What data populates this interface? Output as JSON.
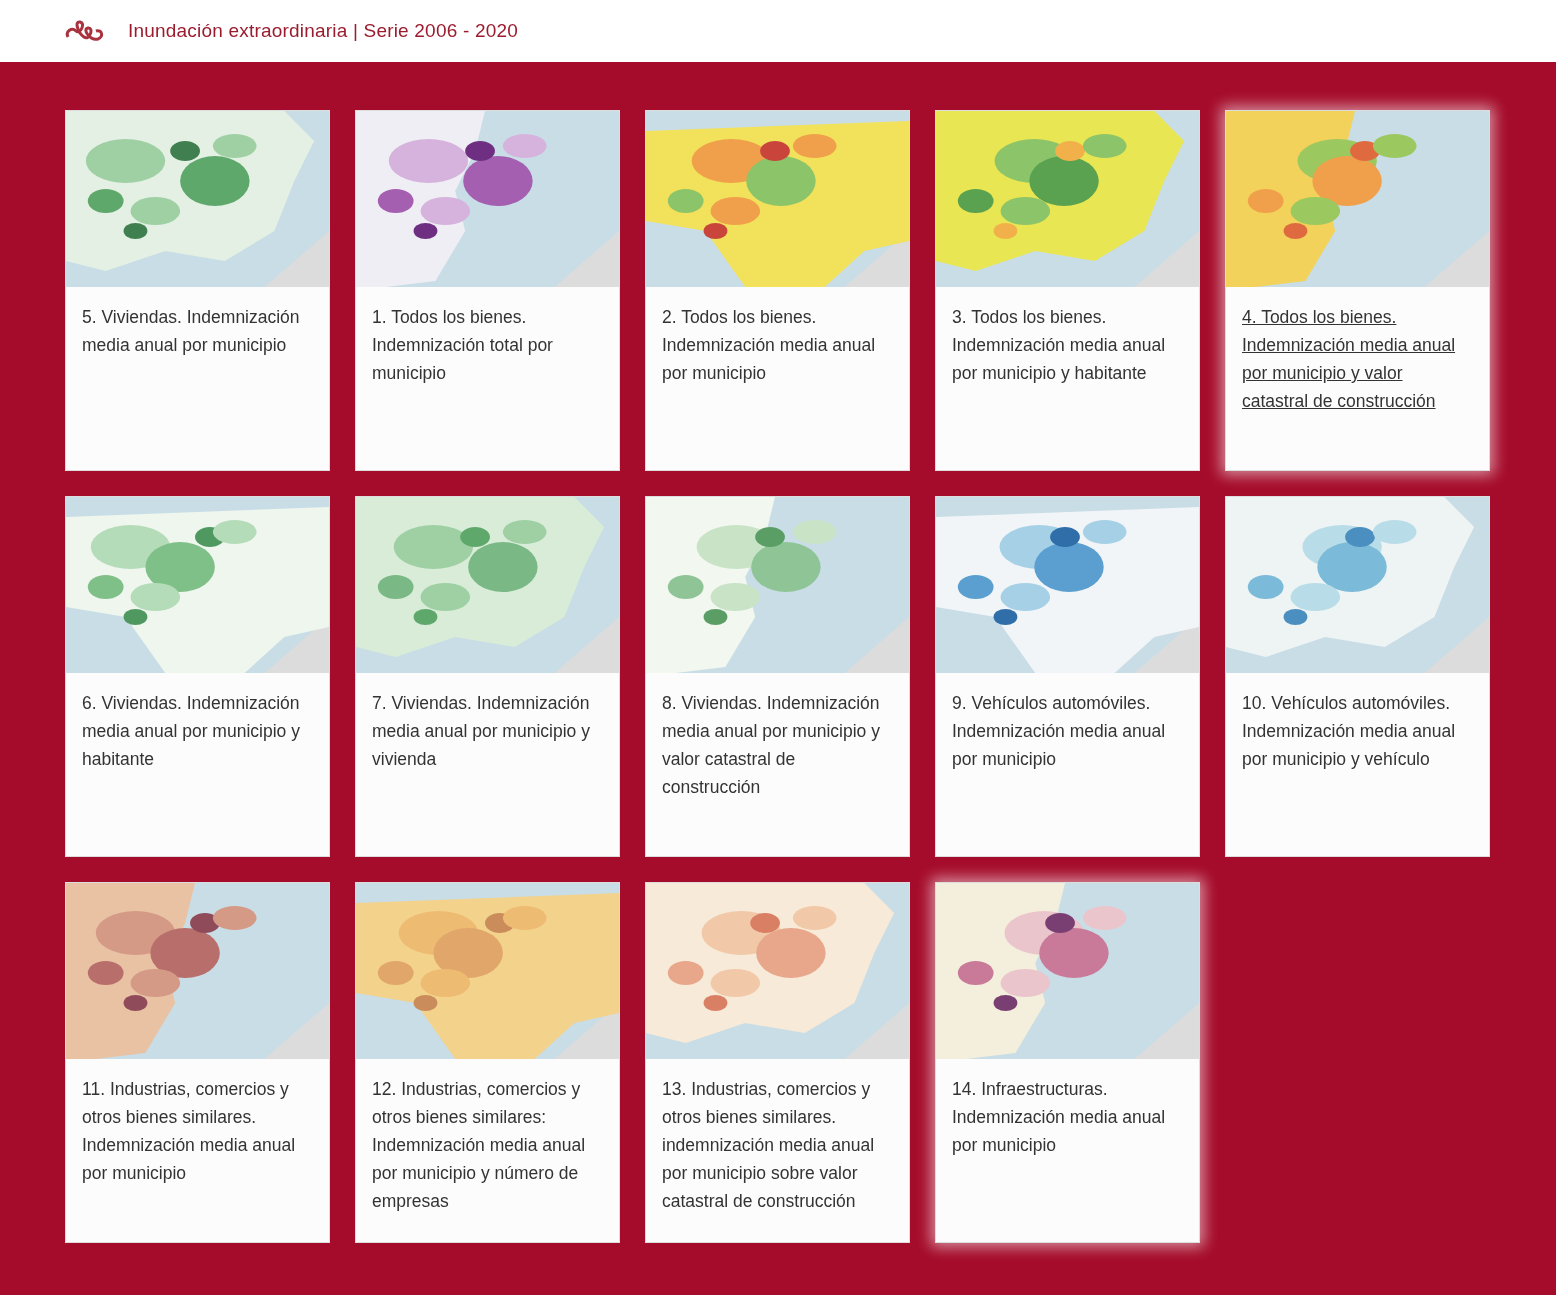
{
  "header": {
    "title": "Inundación extraordinaria | Serie 2006 - 2020"
  },
  "cards": [
    {
      "kind": "picture",
      "title": "5. Viviendas. Indemnización media anual por municipio",
      "hovered": false,
      "highlighted": false
    },
    {
      "kind": "picture",
      "title": "1. Todos los bienes. Indemnización total por municipio",
      "hovered": false,
      "highlighted": false
    },
    {
      "kind": "picture",
      "title": "2. Todos los bienes. Indemnización media anual por municipio",
      "hovered": false,
      "highlighted": false
    },
    {
      "kind": "picture",
      "title": "3. Todos los bienes. Indemnización media anual por municipio y habitante",
      "hovered": false,
      "highlighted": false
    },
    {
      "kind": "picture",
      "title": "4. Todos los bienes. Indemnización media anual por municipio y valor catastral de construcción",
      "hovered": true,
      "highlighted": true
    },
    {
      "kind": "picture",
      "title": "6. Viviendas. Indemnización media anual por municipio y habitante",
      "hovered": false,
      "highlighted": false
    },
    {
      "kind": "picture",
      "title": "7. Viviendas. Indemnización media anual por municipio y vivienda",
      "hovered": false,
      "highlighted": false
    },
    {
      "kind": "picture",
      "title": "8. Viviendas. Indemnización media anual por municipio y valor catastral de construcción",
      "hovered": false,
      "highlighted": false
    },
    {
      "kind": "picture",
      "title": "9. Vehículos automóviles. Indemnización media anual por municipio",
      "hovered": false,
      "highlighted": false
    },
    {
      "kind": "picture",
      "title": "10. Vehículos automóviles. Indemnización media anual por municipio y vehículo",
      "hovered": false,
      "highlighted": false
    },
    {
      "kind": "picture",
      "title": "11. Industrias, comercios y otros bienes similares. Indemnización media anual por municipio",
      "hovered": false,
      "highlighted": false
    },
    {
      "kind": "picture",
      "title": "12. Industrias, comercios y otros bienes similares: Indemnización media anual por municipio y número de empresas",
      "hovered": false,
      "highlighted": false
    },
    {
      "kind": "picture",
      "title": "13. Industrias, comercios y otros bienes similares. indemnización media anual por municipio sobre valor catastral de construcción",
      "hovered": false,
      "highlighted": false
    },
    {
      "kind": "picture",
      "title": "14. Infraestructuras. Indemnización media anual por municipio",
      "hovered": false,
      "highlighted": true
    }
  ]
}
